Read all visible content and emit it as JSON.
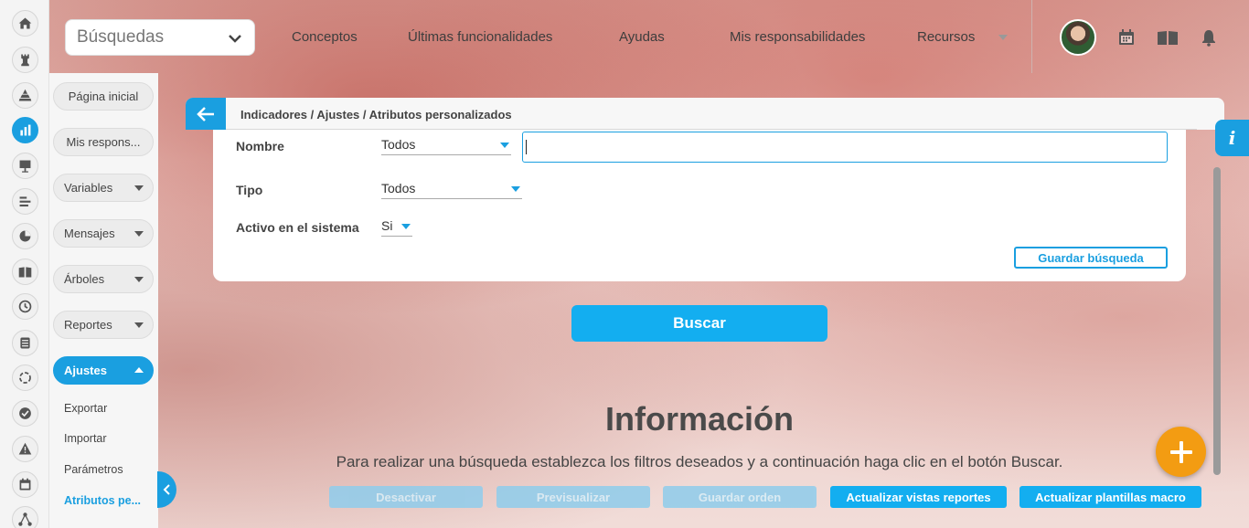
{
  "topbar": {
    "search_select": "Búsquedas",
    "nav": [
      "Conceptos",
      "Últimas funcionalidades",
      "Ayudas",
      "Mis responsabilidades",
      "Recursos"
    ],
    "icons": [
      "avatar",
      "calendar-icon",
      "book-icon",
      "bell-icon"
    ]
  },
  "rail": {
    "icons": [
      "home-icon",
      "chess-rook-icon",
      "pyramid-icon",
      "bar-chart-icon",
      "presentation-icon",
      "align-icon",
      "pie-chart-icon",
      "book-icon",
      "clock-icon",
      "list-icon",
      "cycle-icon",
      "check-icon",
      "warning-icon",
      "calendar-icon",
      "network-icon"
    ],
    "active_index": 3
  },
  "sidebar": {
    "items": [
      {
        "label": "Página inicial"
      },
      {
        "label": "Mis respons..."
      },
      {
        "label": "Variables"
      },
      {
        "label": "Mensajes"
      },
      {
        "label": "Árboles"
      },
      {
        "label": "Reportes"
      },
      {
        "label": "Ajustes"
      }
    ],
    "subitems": [
      "Exportar",
      "Importar",
      "Parámetros",
      "Atributos pe..."
    ]
  },
  "card": {
    "breadcrumb": "Indicadores / Ajustes / Atributos personalizados",
    "form": {
      "nombre_label": "Nombre",
      "nombre_select": "Todos",
      "nombre_text": "",
      "tipo_label": "Tipo",
      "tipo_select": "Todos",
      "activo_label": "Activo en el sistema",
      "activo_select": "Si",
      "save_search": "Guardar búsqueda"
    },
    "search_button": "Buscar",
    "info_title": "Información",
    "info_text": "Para realizar una búsqueda establezca los filtros deseados y a continuación haga clic en el botón Buscar.",
    "actions": [
      {
        "label": "Desactivar",
        "enabled": false
      },
      {
        "label": "Previsualizar",
        "enabled": false
      },
      {
        "label": "Guardar orden",
        "enabled": false
      },
      {
        "label": "Actualizar vistas reportes",
        "enabled": true
      },
      {
        "label": "Actualizar plantillas macro",
        "enabled": true
      }
    ]
  },
  "info_tab": "i",
  "colors": {
    "accent": "#1a9fe0",
    "button": "#13aef0",
    "fab": "#f39c12"
  }
}
